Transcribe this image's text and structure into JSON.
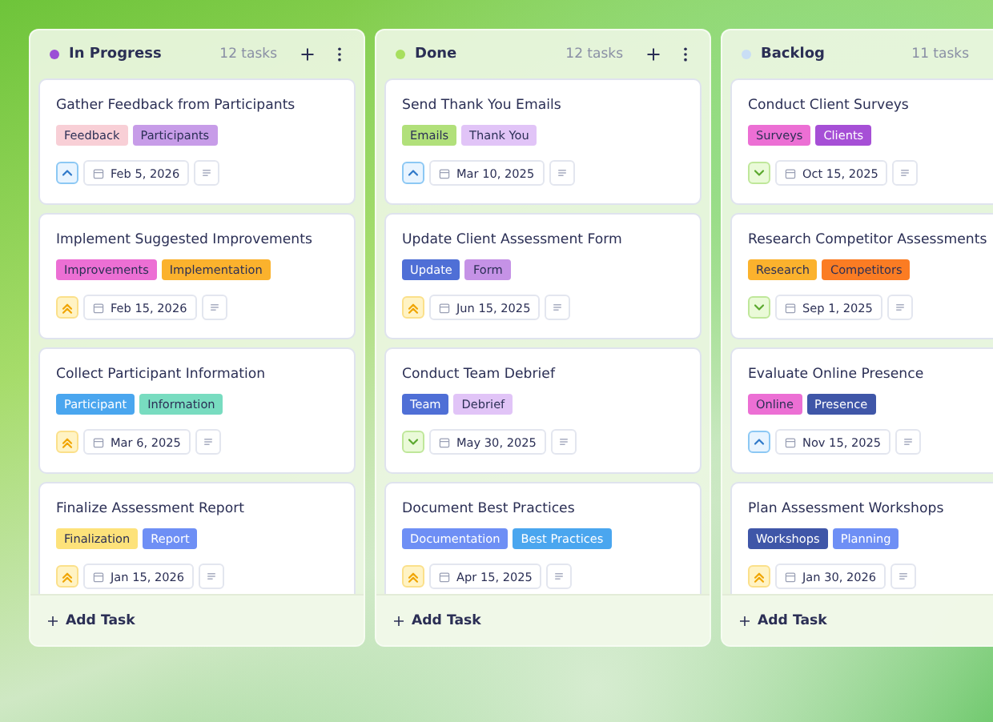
{
  "columns": [
    {
      "title": "In Progress",
      "color": "#9b4fd6",
      "count": "12 tasks",
      "add_label": "Add Task",
      "cards": [
        {
          "title": "Gather Feedback from Participants",
          "tags": [
            {
              "label": "Feedback",
              "color": "#f8cfd6"
            },
            {
              "label": "Participants",
              "color": "#c79ce8"
            }
          ],
          "priority": {
            "kind": "medium"
          },
          "date": "Feb 5, 2026"
        },
        {
          "title": "Implement Suggested Improvements",
          "tags": [
            {
              "label": "Improvements",
              "color": "#ec6fd4"
            },
            {
              "label": "Implementation",
              "color": "#fbb22d"
            }
          ],
          "priority": {
            "kind": "high"
          },
          "date": "Feb 15, 2026"
        },
        {
          "title": "Collect Participant Information",
          "tags": [
            {
              "label": "Participant",
              "color": "#4aa6ef"
            },
            {
              "label": "Information",
              "color": "#78dcc0"
            }
          ],
          "priority": {
            "kind": "high"
          },
          "date": "Mar 6, 2025"
        },
        {
          "title": "Finalize Assessment Report",
          "tags": [
            {
              "label": "Finalization",
              "color": "#fde27a"
            },
            {
              "label": "Report",
              "color": "#6e8ff5"
            }
          ],
          "priority": {
            "kind": "high"
          },
          "date": "Jan 15, 2026"
        }
      ]
    },
    {
      "title": "Done",
      "color": "#a7df5e",
      "count": "12 tasks",
      "add_label": "Add Task",
      "cards": [
        {
          "title": "Send Thank You Emails",
          "tags": [
            {
              "label": "Emails",
              "color": "#b1e07a"
            },
            {
              "label": "Thank You",
              "color": "#e1c4f7"
            }
          ],
          "priority": {
            "kind": "medium"
          },
          "date": "Mar 10, 2025"
        },
        {
          "title": "Update Client Assessment Form",
          "tags": [
            {
              "label": "Update",
              "color": "#4f6fd6"
            },
            {
              "label": "Form",
              "color": "#c592e6"
            }
          ],
          "priority": {
            "kind": "high"
          },
          "date": "Jun 15, 2025"
        },
        {
          "title": "Conduct Team Debrief",
          "tags": [
            {
              "label": "Team",
              "color": "#4f6fd6"
            },
            {
              "label": "Debrief",
              "color": "#e1c4f7"
            }
          ],
          "priority": {
            "kind": "low"
          },
          "date": "May 30, 2025"
        },
        {
          "title": "Document Best Practices",
          "tags": [
            {
              "label": "Documentation",
              "color": "#6e8ff5"
            },
            {
              "label": "Best Practices",
              "color": "#4aa6ef"
            }
          ],
          "priority": {
            "kind": "high"
          },
          "date": "Apr 15, 2025"
        }
      ]
    },
    {
      "title": "Backlog",
      "color": "#c9def5",
      "count": "11 tasks",
      "add_label": "Add Task",
      "cards": [
        {
          "title": "Conduct Client Surveys",
          "tags": [
            {
              "label": "Surveys",
              "color": "#ec6fd4"
            },
            {
              "label": "Clients",
              "color": "#a64fd6"
            }
          ],
          "priority": {
            "kind": "low"
          },
          "date": "Oct 15, 2025"
        },
        {
          "title": "Research Competitor Assessments",
          "tags": [
            {
              "label": "Research",
              "color": "#fbb22d"
            },
            {
              "label": "Competitors",
              "color": "#fb7c23"
            }
          ],
          "priority": {
            "kind": "low"
          },
          "date": "Sep 1, 2025"
        },
        {
          "title": "Evaluate Online Presence",
          "tags": [
            {
              "label": "Online",
              "color": "#ec6fd4"
            },
            {
              "label": "Presence",
              "color": "#3f56a8"
            }
          ],
          "priority": {
            "kind": "medium"
          },
          "date": "Nov 15, 2025"
        },
        {
          "title": "Plan Assessment Workshops",
          "tags": [
            {
              "label": "Workshops",
              "color": "#3f56a8"
            },
            {
              "label": "Planning",
              "color": "#6e8ff5"
            }
          ],
          "priority": {
            "kind": "high"
          },
          "date": "Jan 30, 2026"
        }
      ]
    }
  ]
}
